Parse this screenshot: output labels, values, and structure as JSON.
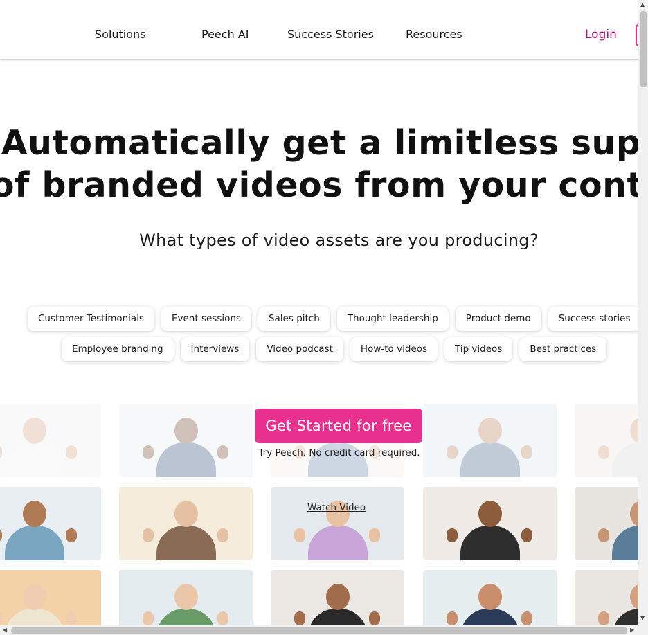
{
  "nav": {
    "items": [
      "Solutions",
      "Peech AI",
      "Success Stories",
      "Resources"
    ],
    "login": "Login"
  },
  "hero": {
    "headline_line1": "Automatically get a limitless suppl",
    "headline_line2": "of branded videos from your conte",
    "subhead": "What types of video assets are you producing?"
  },
  "chips": {
    "row1": [
      "Customer Testimonials",
      "Event sessions",
      "Sales pitch",
      "Thought leadership",
      "Product demo",
      "Success stories"
    ],
    "row2": [
      "Employee branding",
      "Interviews",
      "Video podcast",
      "How-to videos",
      "Tip videos",
      "Best practices"
    ]
  },
  "cta": {
    "button": "Get Started for free",
    "note": "Try Peech. No credit card required.",
    "watch": "Watch Video"
  },
  "colors": {
    "brand_pink": "#e8308f",
    "login_text": "#b5177a"
  }
}
